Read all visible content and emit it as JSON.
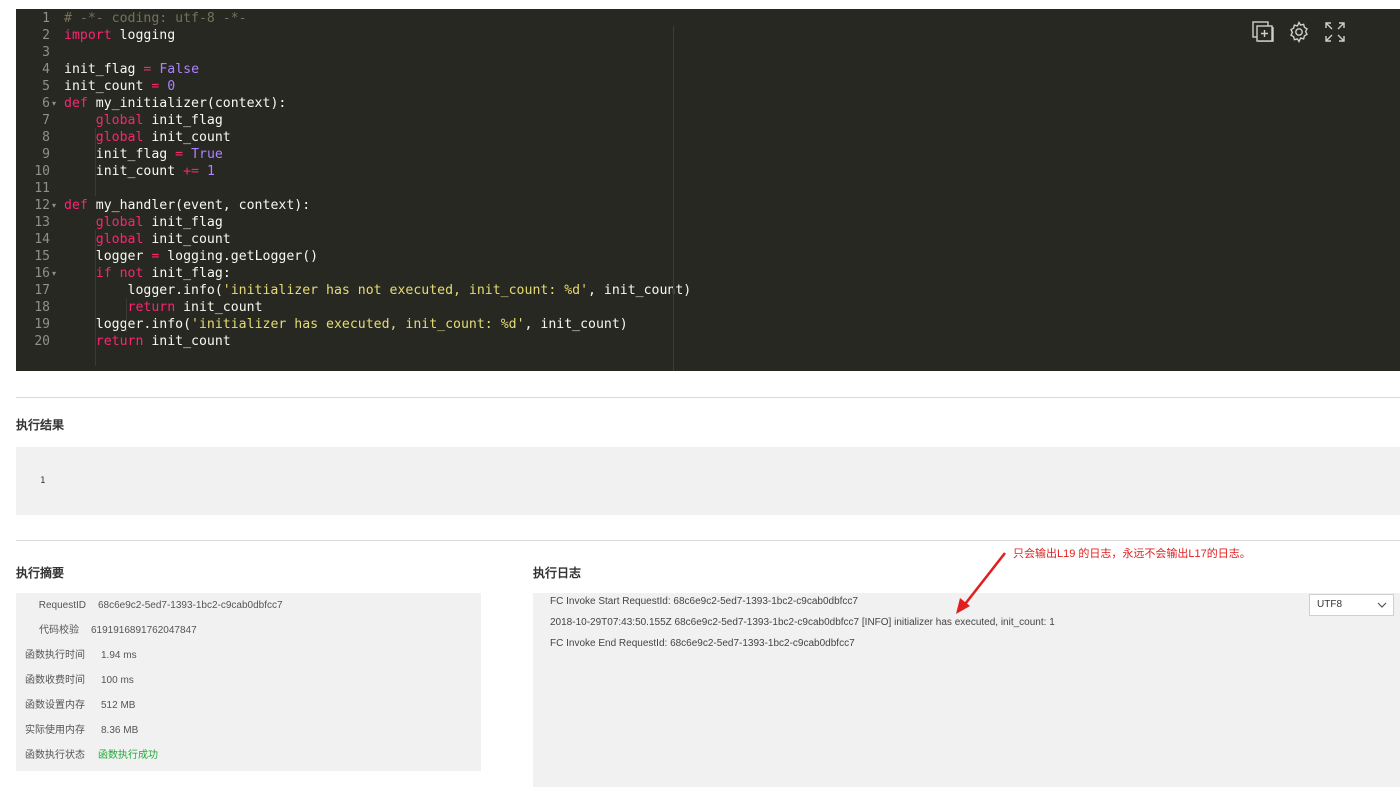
{
  "editor": {
    "line_numbers": [
      "1",
      "2",
      "3",
      "4",
      "5",
      "6",
      "7",
      "8",
      "9",
      "10",
      "11",
      "12",
      "13",
      "14",
      "15",
      "16",
      "17",
      "18",
      "19",
      "20"
    ],
    "fold_lines": [
      "6",
      "12",
      "16"
    ],
    "fold_marker": "▾",
    "lines": [
      [
        {
          "t": "# -*- coding: utf-8 -*-",
          "c": "cm"
        }
      ],
      [
        {
          "t": "import",
          "c": "kw"
        },
        {
          "t": " logging",
          "c": ""
        }
      ],
      [],
      [
        {
          "t": "init_flag ",
          "c": ""
        },
        {
          "t": "=",
          "c": "op"
        },
        {
          "t": " ",
          "c": ""
        },
        {
          "t": "False",
          "c": "bool"
        }
      ],
      [
        {
          "t": "init_count ",
          "c": ""
        },
        {
          "t": "=",
          "c": "op"
        },
        {
          "t": " ",
          "c": ""
        },
        {
          "t": "0",
          "c": "num"
        }
      ],
      [
        {
          "t": "def",
          "c": "kw"
        },
        {
          "t": " my_initializer(context):",
          "c": ""
        }
      ],
      [
        {
          "t": "    ",
          "c": ""
        },
        {
          "t": "global",
          "c": "kw"
        },
        {
          "t": " init_flag",
          "c": ""
        }
      ],
      [
        {
          "t": "    ",
          "c": ""
        },
        {
          "t": "global",
          "c": "kw"
        },
        {
          "t": " init_count",
          "c": ""
        }
      ],
      [
        {
          "t": "    init_flag ",
          "c": ""
        },
        {
          "t": "=",
          "c": "op"
        },
        {
          "t": " ",
          "c": ""
        },
        {
          "t": "True",
          "c": "bool"
        }
      ],
      [
        {
          "t": "    init_count ",
          "c": ""
        },
        {
          "t": "+=",
          "c": "op"
        },
        {
          "t": " ",
          "c": ""
        },
        {
          "t": "1",
          "c": "num"
        }
      ],
      [],
      [
        {
          "t": "def",
          "c": "kw"
        },
        {
          "t": " my_handler(event, context):",
          "c": ""
        }
      ],
      [
        {
          "t": "    ",
          "c": ""
        },
        {
          "t": "global",
          "c": "kw"
        },
        {
          "t": " init_flag",
          "c": ""
        }
      ],
      [
        {
          "t": "    ",
          "c": ""
        },
        {
          "t": "global",
          "c": "kw"
        },
        {
          "t": " init_count",
          "c": ""
        }
      ],
      [
        {
          "t": "    logger ",
          "c": ""
        },
        {
          "t": "=",
          "c": "op"
        },
        {
          "t": " logging.getLogger()",
          "c": ""
        }
      ],
      [
        {
          "t": "    ",
          "c": ""
        },
        {
          "t": "if",
          "c": "kw"
        },
        {
          "t": " ",
          "c": ""
        },
        {
          "t": "not",
          "c": "kw"
        },
        {
          "t": " init_flag:",
          "c": ""
        }
      ],
      [
        {
          "t": "        logger.info(",
          "c": ""
        },
        {
          "t": "'initializer has not executed, init_count: %d'",
          "c": "str"
        },
        {
          "t": ", init_count)",
          "c": ""
        }
      ],
      [
        {
          "t": "        ",
          "c": ""
        },
        {
          "t": "return",
          "c": "kw"
        },
        {
          "t": " init_count",
          "c": ""
        }
      ],
      [
        {
          "t": "    logger.info(",
          "c": ""
        },
        {
          "t": "'initializer has executed, init_count: %d'",
          "c": "str"
        },
        {
          "t": ", init_count)",
          "c": ""
        }
      ],
      [
        {
          "t": "    ",
          "c": ""
        },
        {
          "t": "return",
          "c": "kw"
        },
        {
          "t": " init_count",
          "c": ""
        }
      ]
    ],
    "tools": [
      {
        "name": "add-file-icon"
      },
      {
        "name": "gear-icon"
      },
      {
        "name": "expand-icon"
      }
    ]
  },
  "result": {
    "title": "执行结果",
    "value": "1"
  },
  "summary": {
    "title": "执行摘要",
    "rows": [
      {
        "key": "RequestID",
        "value": "68c6e9c2-5ed7-1393-1bc2-c9cab0dbfcc7"
      },
      {
        "key": "代码校验",
        "value": "6191916891762047847"
      },
      {
        "key": "函数执行时间",
        "value": "1.94 ms"
      },
      {
        "key": "函数收费时间",
        "value": "100 ms"
      },
      {
        "key": "函数设置内存",
        "value": "512 MB"
      },
      {
        "key": "实际使用内存",
        "value": "8.36 MB"
      },
      {
        "key": "函数执行状态",
        "value": "函数执行成功",
        "status": "success"
      }
    ]
  },
  "log": {
    "title": "执行日志",
    "lines": [
      "FC Invoke Start RequestId: 68c6e9c2-5ed7-1393-1bc2-c9cab0dbfcc7",
      "2018-10-29T07:43:50.155Z 68c6e9c2-5ed7-1393-1bc2-c9cab0dbfcc7 [INFO] initializer has executed, init_count: 1",
      "FC Invoke End RequestId: 68c6e9c2-5ed7-1393-1bc2-c9cab0dbfcc7"
    ],
    "encoding": "UTF8"
  },
  "annotation": {
    "text": "只会输出L19 的日志，永远不会输出L17的日志。"
  },
  "colors": {
    "editor_bg": "#272822",
    "success": "#22a83a",
    "annotation": "#e02020"
  }
}
